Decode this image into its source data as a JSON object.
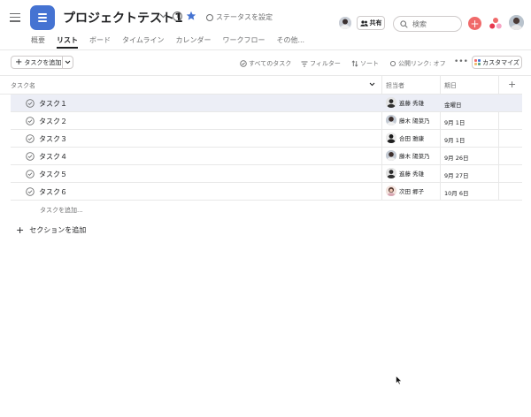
{
  "header": {
    "project_title": "プロジェクトテスト1",
    "status_label": "ステータスを設定",
    "share_label": "共有",
    "search_placeholder": "検索"
  },
  "tabs": [
    {
      "label": "概要"
    },
    {
      "label": "リスト"
    },
    {
      "label": "ボード"
    },
    {
      "label": "タイムライン"
    },
    {
      "label": "カレンダー"
    },
    {
      "label": "ワークフロー"
    },
    {
      "label": "その他..."
    }
  ],
  "active_tab": "リスト",
  "toolbar": {
    "add_task_label": "タスクを追加",
    "all_tasks_label": "すべてのタスク",
    "filter_label": "フィルター",
    "sort_label": "ソート",
    "public_link_label": "公開リンク: オフ",
    "more_label": "•••",
    "customize_label": "カスタマイズ"
  },
  "table": {
    "headers": {
      "task_name": "タスク名",
      "assignee": "担当者",
      "due_date": "期日"
    },
    "rows": [
      {
        "name": "タスク１",
        "assignee": "進藤 秀雄",
        "due": "金曜日"
      },
      {
        "name": "タスク２",
        "assignee": "藤木 陽菜乃",
        "due": "9月 1日"
      },
      {
        "name": "タスク３",
        "assignee": "合田 雅康",
        "due": "9月 1日"
      },
      {
        "name": "タスク４",
        "assignee": "藤木 陽菜乃",
        "due": "9月 26日"
      },
      {
        "name": "タスク５",
        "assignee": "進藤 秀雄",
        "due": "9月 27日"
      },
      {
        "name": "タスク６",
        "assignee": "次田 郷子",
        "due": "10月 6日"
      }
    ],
    "add_task_link": "タスクを追加...",
    "add_section_label": "セクションを追加"
  },
  "colors": {
    "accent_blue": "#4573d2",
    "primary_red": "#f06a6a",
    "highlight_row": "#eceef6",
    "star": "#4573d2"
  }
}
